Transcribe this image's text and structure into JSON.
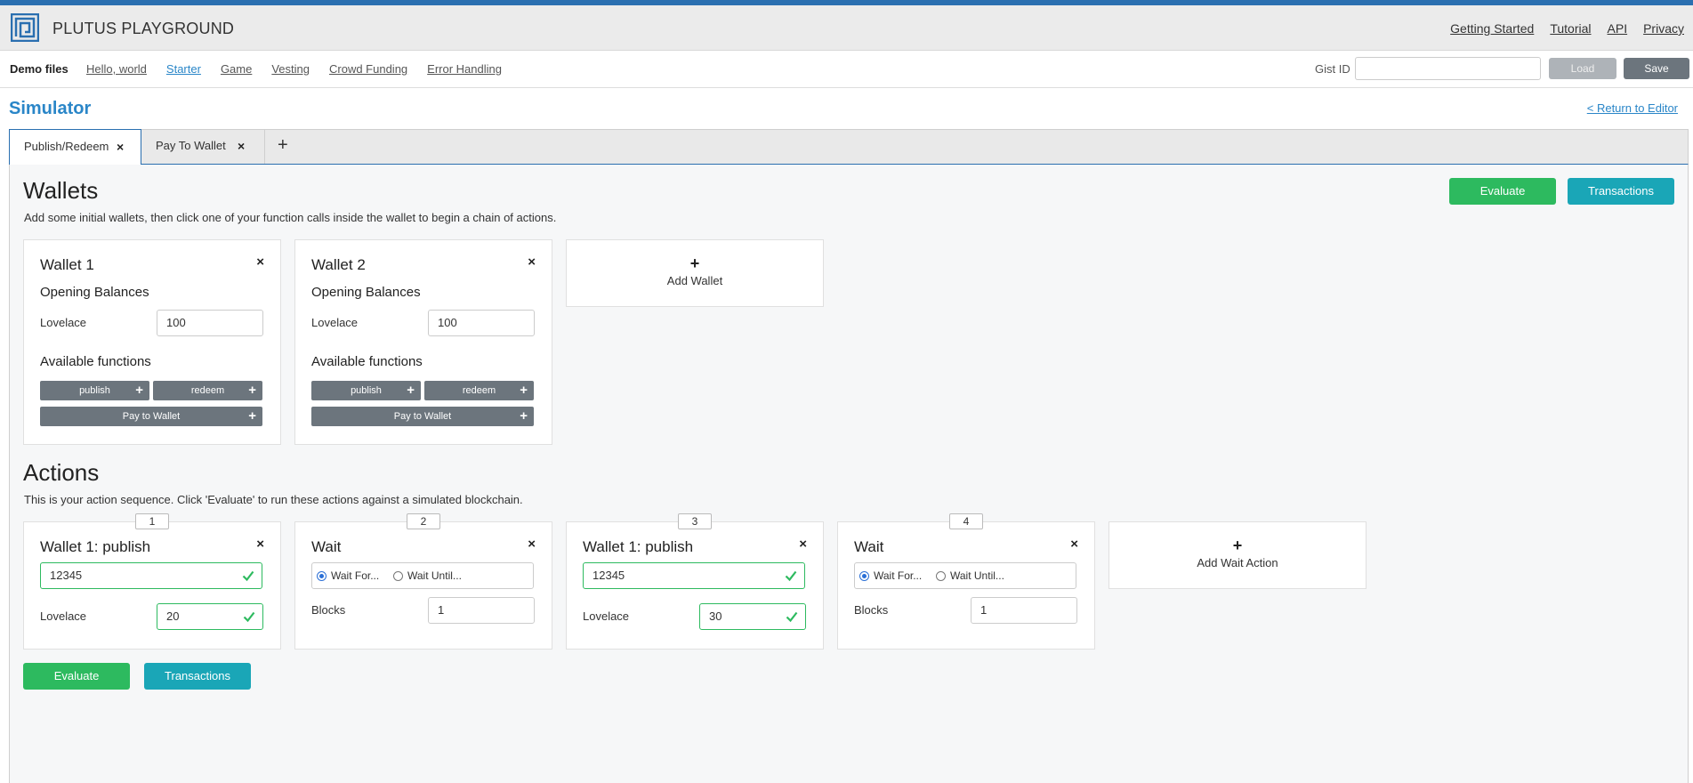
{
  "app": {
    "title": "PLUTUS PLAYGROUND"
  },
  "topnav": {
    "items": [
      "Getting Started",
      "Tutorial",
      "API",
      "Privacy"
    ]
  },
  "demo": {
    "label": "Demo files",
    "links": [
      "Hello, world",
      "Starter",
      "Game",
      "Vesting",
      "Crowd Funding",
      "Error Handling"
    ],
    "active": "Starter",
    "gist_label": "Gist ID",
    "gist_value": "",
    "load_label": "Load",
    "save_label": "Save"
  },
  "page": {
    "title": "Simulator",
    "return_label": "< Return to Editor"
  },
  "tabs": [
    {
      "label": "Publish/Redeem",
      "close": "×",
      "active": true
    },
    {
      "label": "Pay To Wallet",
      "close": "×",
      "active": false
    }
  ],
  "tab_add": "+",
  "wallets": {
    "heading": "Wallets",
    "description": "Add some initial wallets, then click one of your function calls inside the wallet to begin a chain of actions.",
    "evaluate_label": "Evaluate",
    "transactions_label": "Transactions",
    "items": [
      {
        "title": "Wallet 1",
        "close": "×",
        "balances_heading": "Opening Balances",
        "currency": "Lovelace",
        "amount": "100",
        "functions_heading": "Available functions",
        "functions": [
          "publish",
          "redeem",
          "Pay to Wallet"
        ]
      },
      {
        "title": "Wallet 2",
        "close": "×",
        "balances_heading": "Opening Balances",
        "currency": "Lovelace",
        "amount": "100",
        "functions_heading": "Available functions",
        "functions": [
          "publish",
          "redeem",
          "Pay to Wallet"
        ]
      }
    ],
    "add_label": "Add Wallet",
    "add_plus": "+",
    "fn_plus": "+"
  },
  "actions": {
    "heading": "Actions",
    "description": "This is your action sequence. Click 'Evaluate' to run these actions against a simulated blockchain.",
    "items": [
      {
        "number": "1",
        "title": "Wallet 1: publish",
        "close": "×",
        "value": "12345",
        "currency": "Lovelace",
        "amount": "20"
      },
      {
        "number": "2",
        "title": "Wait",
        "close": "×",
        "wait_for": "Wait For...",
        "wait_until": "Wait Until...",
        "blocks_label": "Blocks",
        "blocks": "1"
      },
      {
        "number": "3",
        "title": "Wallet 1: publish",
        "close": "×",
        "value": "12345",
        "currency": "Lovelace",
        "amount": "30"
      },
      {
        "number": "4",
        "title": "Wait",
        "close": "×",
        "wait_for": "Wait For...",
        "wait_until": "Wait Until...",
        "blocks_label": "Blocks",
        "blocks": "1"
      }
    ],
    "add_label": "Add Wait Action",
    "add_plus": "+",
    "evaluate_label": "Evaluate",
    "transactions_label": "Transactions"
  },
  "colors": {
    "brand_blue": "#2a86c8",
    "green": "#2dba5f",
    "teal": "#1aa6b7",
    "gray_button": "#6c757d"
  }
}
